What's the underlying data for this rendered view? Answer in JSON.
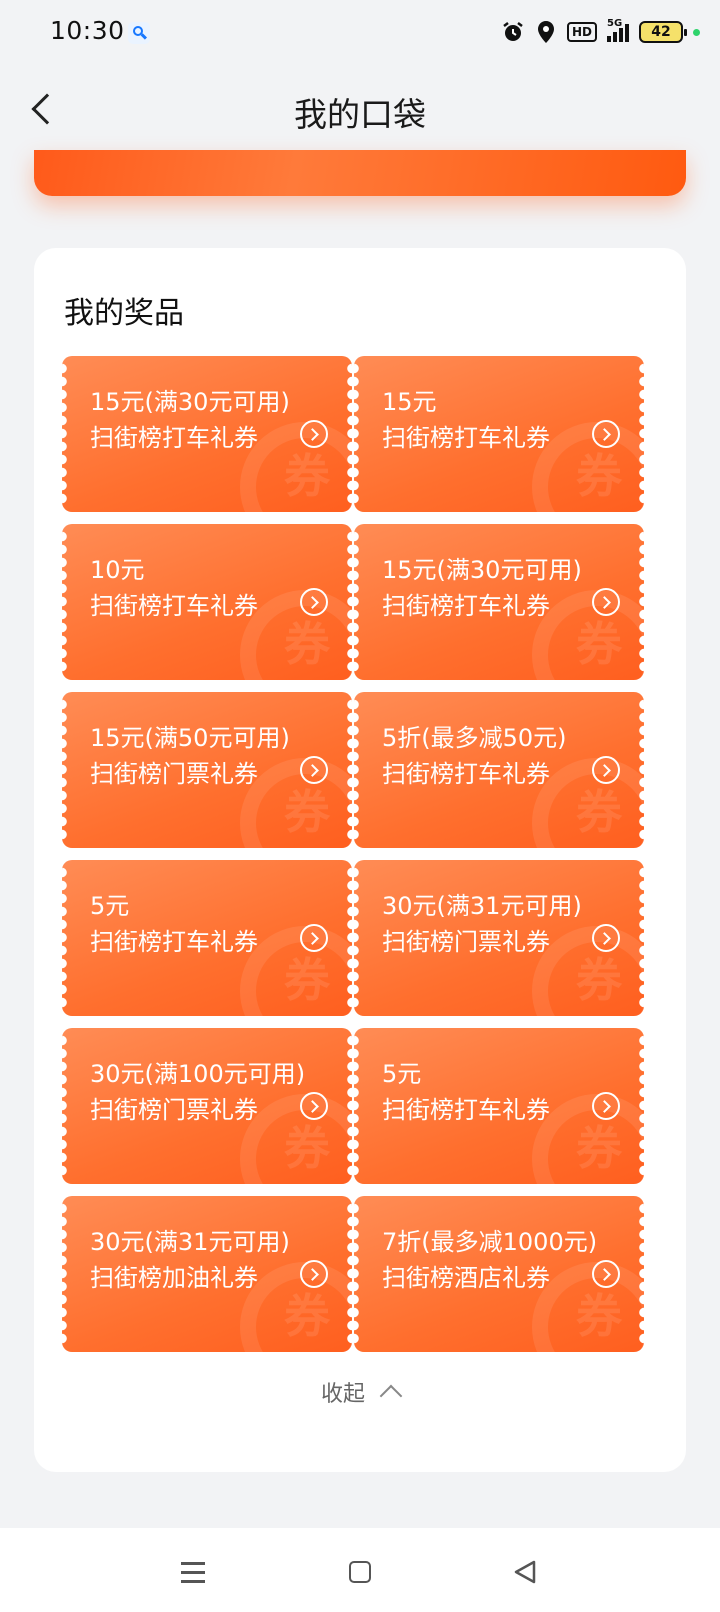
{
  "status_bar": {
    "time": "10:30",
    "network": "5G",
    "hd": "HD",
    "battery": "42"
  },
  "header": {
    "title": "我的口袋"
  },
  "prizes": {
    "title": "我的奖品",
    "coupons": [
      {
        "value": "15元(满30元可用)",
        "name": "扫街榜打车礼券"
      },
      {
        "value": "15元",
        "name": "扫街榜打车礼券"
      },
      {
        "value": "10元",
        "name": "扫街榜打车礼券"
      },
      {
        "value": "15元(满30元可用)",
        "name": "扫街榜打车礼券"
      },
      {
        "value": "15元(满50元可用)",
        "name": "扫街榜门票礼券"
      },
      {
        "value": "5折(最多减50元)",
        "name": "扫街榜打车礼券"
      },
      {
        "value": "5元",
        "name": "扫街榜打车礼券"
      },
      {
        "value": "30元(满31元可用)",
        "name": "扫街榜门票礼券"
      },
      {
        "value": "30元(满100元可用)",
        "name": "扫街榜门票礼券"
      },
      {
        "value": "5元",
        "name": "扫街榜打车礼券"
      },
      {
        "value": "30元(满31元可用)",
        "name": "扫街榜加油礼券"
      },
      {
        "value": "7折(最多减1000元)",
        "name": "扫街榜酒店礼券"
      }
    ],
    "watermark": "券",
    "collapse_label": "收起"
  },
  "colors": {
    "accent": "#ff6f2e",
    "page_bg": "#f2f3f5"
  }
}
